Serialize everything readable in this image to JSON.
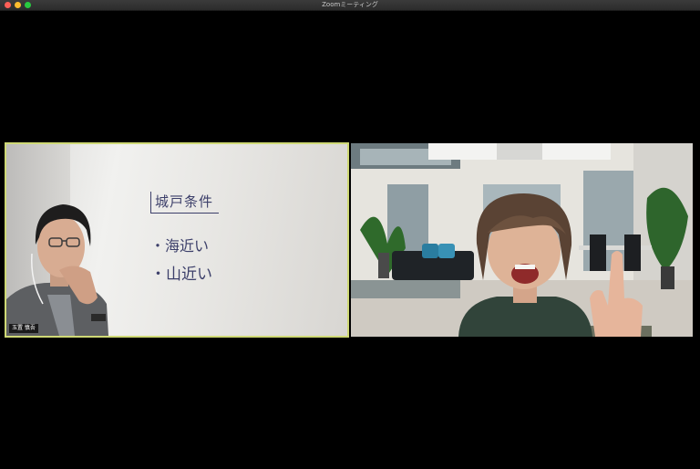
{
  "window": {
    "title": "Zoomミーティング"
  },
  "participants": [
    {
      "name": "玉置 慎吾",
      "whiteboard": {
        "heading": "城戸条件",
        "lines": [
          "・海近い",
          "・山近い"
        ]
      },
      "active_speaker_color": "#cfd976"
    },
    {
      "name": ""
    }
  ]
}
